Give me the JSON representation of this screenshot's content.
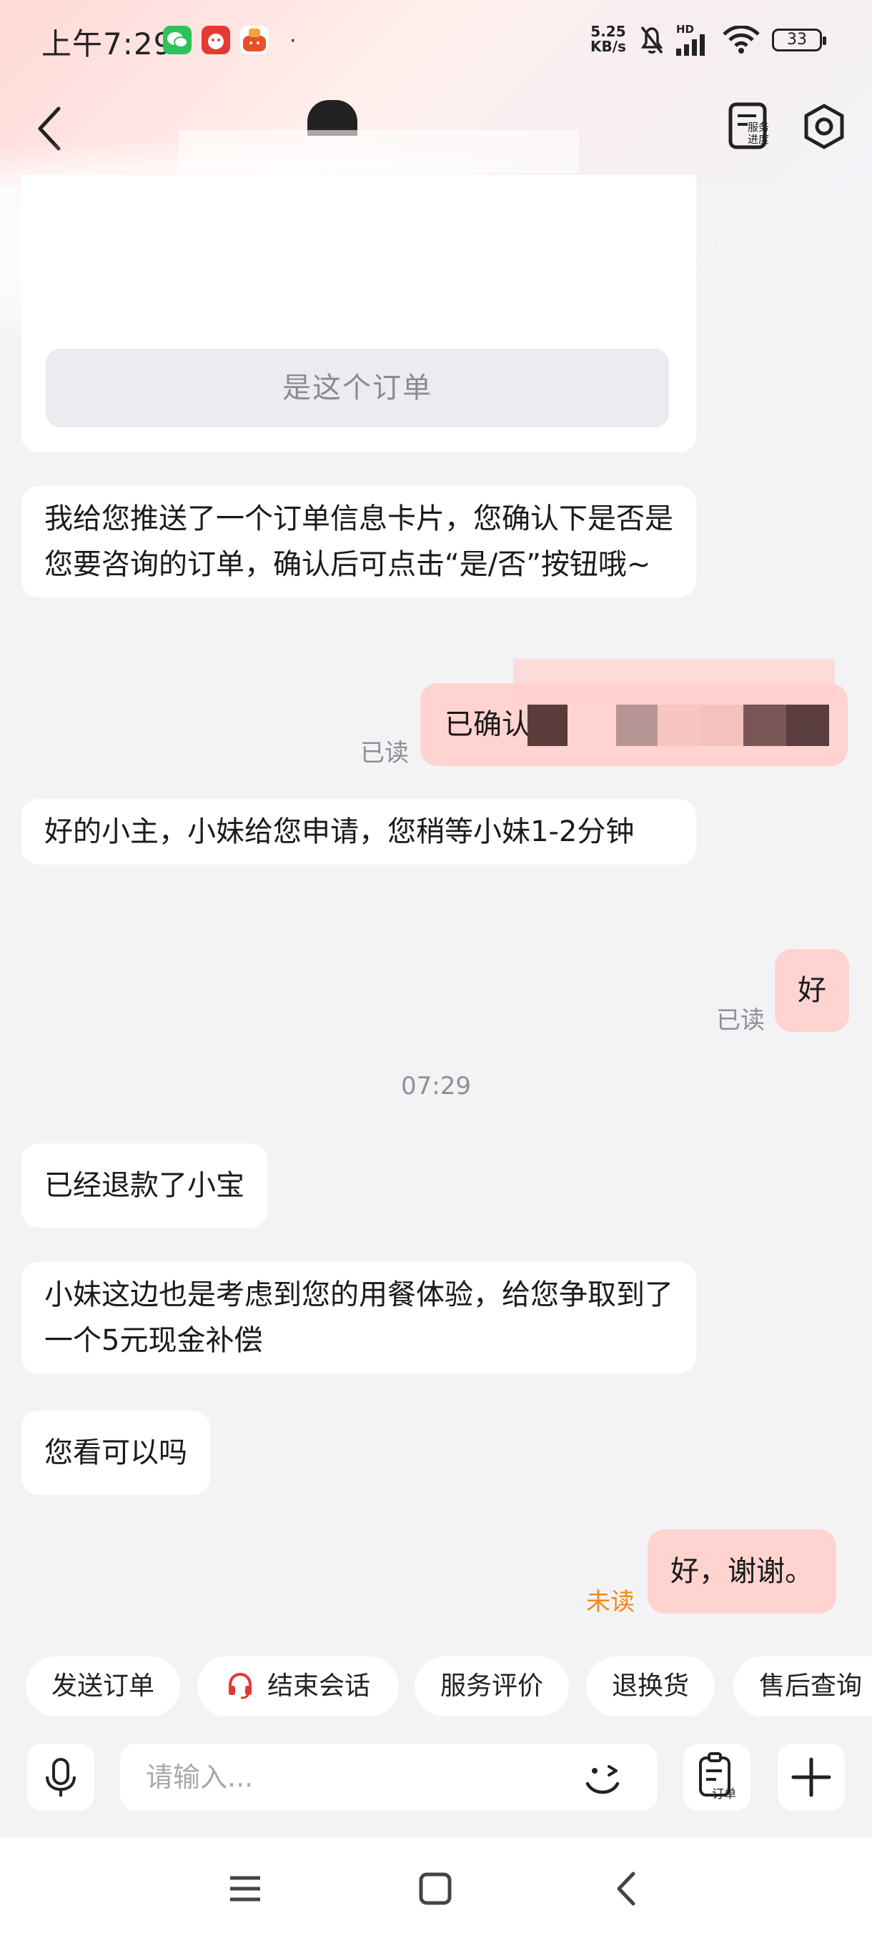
{
  "status_bar": {
    "time": "上午7:29",
    "net_speed_value": "5.25",
    "net_speed_unit": "KB/s",
    "signal_label": "HD",
    "battery": "33"
  },
  "nav": {
    "service_progress_label": "服务进度"
  },
  "chat": {
    "order_card_button": "是这个订单",
    "messages": [
      {
        "from": "agent",
        "text": "我给您推送了一个订单信息卡片，您确认下是否是您要咨询的订单，确认后可点击“是/否”按钮哦~"
      },
      {
        "from": "me",
        "text": "已确认",
        "status": "已读"
      },
      {
        "from": "agent",
        "text": "好的小主，小妹给您申请，您稍等小妹1-2分钟"
      },
      {
        "from": "me",
        "text": "好",
        "status": "已读"
      },
      {
        "from": "agent",
        "text": "已经退款了小宝"
      },
      {
        "from": "agent",
        "text": "小妹这边也是考虑到您的用餐体验，给您争取到了一个5元现金补偿"
      },
      {
        "from": "agent",
        "text": "您看可以吗"
      },
      {
        "from": "me",
        "text": "好，谢谢。",
        "status": "未读"
      }
    ],
    "timestamp": "07:29"
  },
  "quick_actions": [
    "发送订单",
    "结束会话",
    "服务评价",
    "退换货",
    "售后查询"
  ],
  "input": {
    "placeholder": "请输入...",
    "order_button_label": "订单"
  },
  "colors": {
    "my_bubble": "#ffd3d0",
    "unread": "#f08a1f",
    "headset_icon": "#e5372f"
  }
}
